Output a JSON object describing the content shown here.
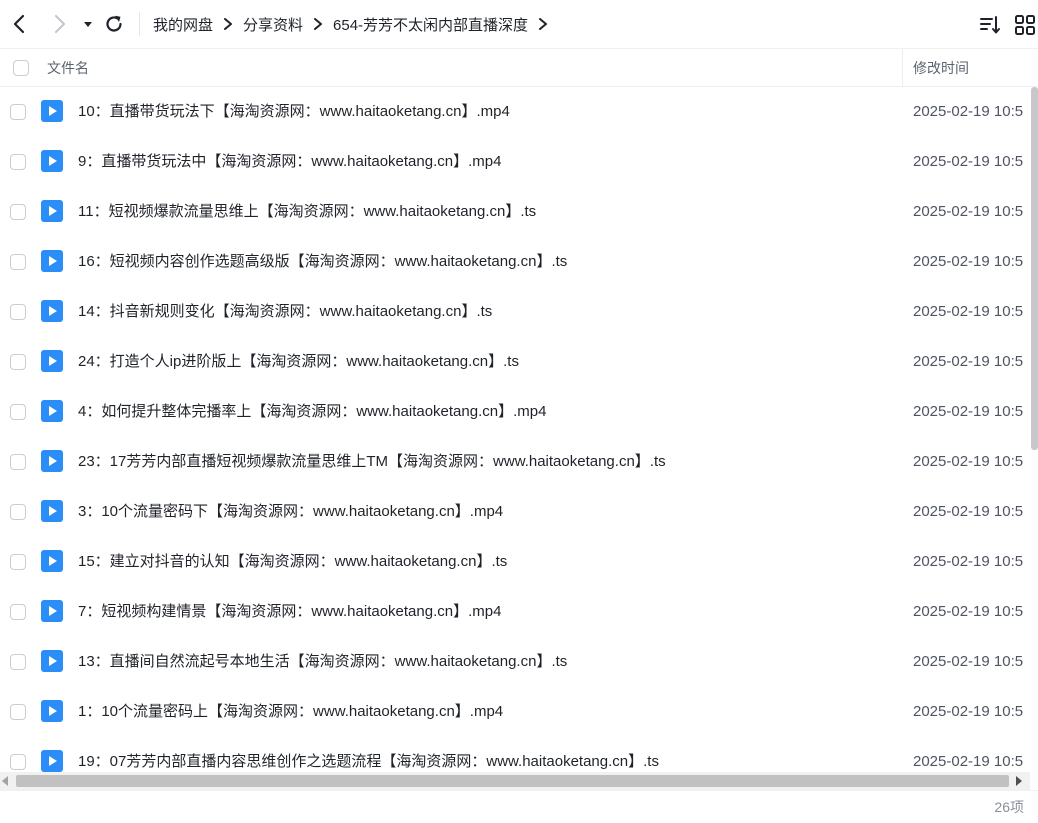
{
  "breadcrumb": [
    "我的网盘",
    "分享资料",
    "654-芳芳不太闲内部直播深度"
  ],
  "header": {
    "name_col": "文件名",
    "time_col": "修改时间"
  },
  "files": [
    {
      "name": "10：直播带货玩法下【海淘资源网：www.haitaoketang.cn】.mp4",
      "time": "2025-02-19 10:5"
    },
    {
      "name": "9：直播带货玩法中【海淘资源网：www.haitaoketang.cn】.mp4",
      "time": "2025-02-19 10:5"
    },
    {
      "name": "11：短视频爆款流量思维上【海淘资源网：www.haitaoketang.cn】.ts",
      "time": "2025-02-19 10:5"
    },
    {
      "name": "16：短视频内容创作选题高级版【海淘资源网：www.haitaoketang.cn】.ts",
      "time": "2025-02-19 10:5"
    },
    {
      "name": "14：抖音新规则变化【海淘资源网：www.haitaoketang.cn】.ts",
      "time": "2025-02-19 10:5"
    },
    {
      "name": "24：打造个人ip进阶版上【海淘资源网：www.haitaoketang.cn】.ts",
      "time": "2025-02-19 10:5"
    },
    {
      "name": "4：如何提升整体完播率上【海淘资源网：www.haitaoketang.cn】.mp4",
      "time": "2025-02-19 10:5"
    },
    {
      "name": "23：17芳芳内部直播短视频爆款流量思维上TM【海淘资源网：www.haitaoketang.cn】.ts",
      "time": "2025-02-19 10:5"
    },
    {
      "name": "3：10个流量密码下【海淘资源网：www.haitaoketang.cn】.mp4",
      "time": "2025-02-19 10:5"
    },
    {
      "name": "15：建立对抖音的认知【海淘资源网：www.haitaoketang.cn】.ts",
      "time": "2025-02-19 10:5"
    },
    {
      "name": "7：短视频构建情景【海淘资源网：www.haitaoketang.cn】.mp4",
      "time": "2025-02-19 10:5"
    },
    {
      "name": "13：直播间自然流起号本地生活【海淘资源网：www.haitaoketang.cn】.ts",
      "time": "2025-02-19 10:5"
    },
    {
      "name": "1：10个流量密码上【海淘资源网：www.haitaoketang.cn】.mp4",
      "time": "2025-02-19 10:5"
    },
    {
      "name": "19：07芳芳内部直播内容思维创作之选题流程【海淘资源网：www.haitaoketang.cn】.ts",
      "time": "2025-02-19 10:5"
    }
  ],
  "footer": {
    "count": "26项"
  },
  "colors": {
    "accent": "#2a8df8",
    "text": "#1f2329",
    "muted": "#5c6370"
  },
  "icons": {
    "back": "chevron-left-icon",
    "forward": "chevron-right-icon",
    "history": "caret-down-icon",
    "refresh": "refresh-icon",
    "sort": "sort-icon",
    "view": "grid-view-icon",
    "file": "video-file-icon"
  }
}
